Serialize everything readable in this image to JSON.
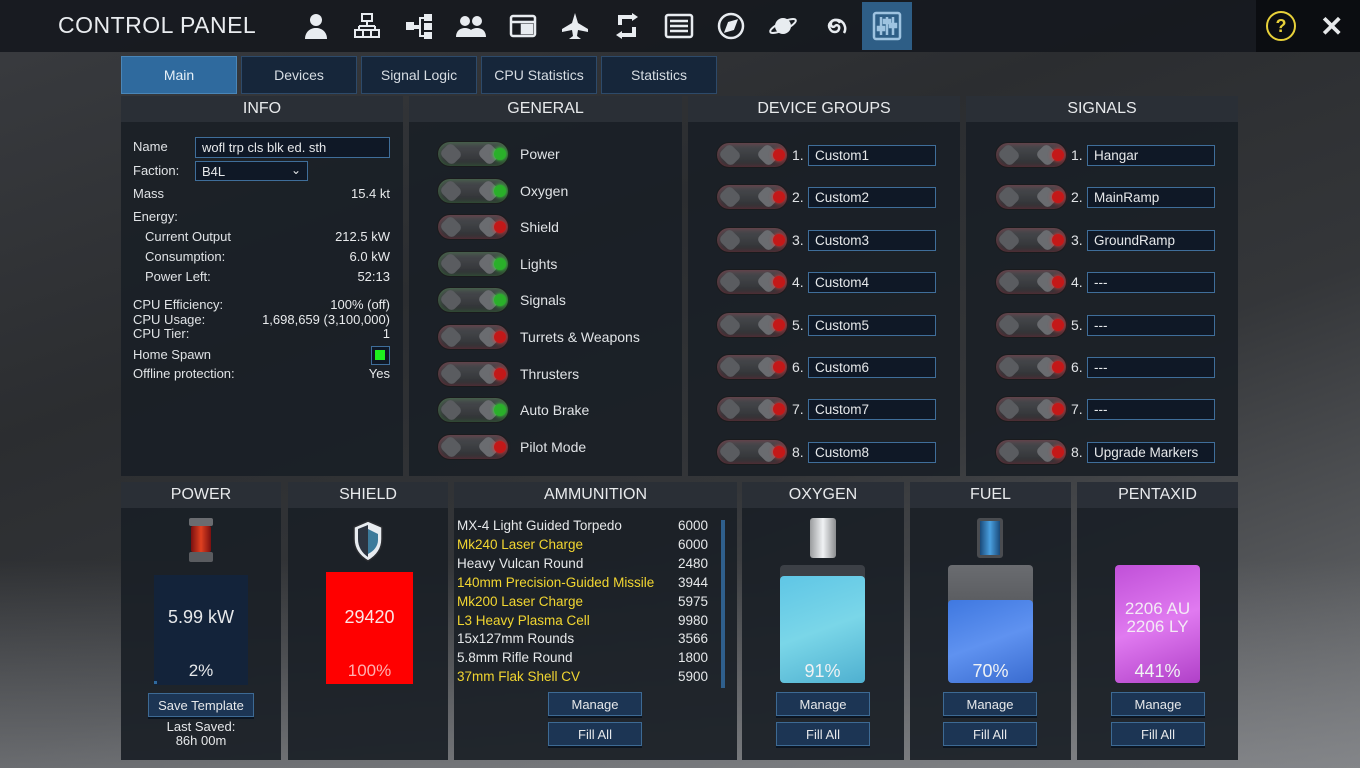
{
  "app": {
    "title": "CONTROL PANEL"
  },
  "toolbar": {
    "icons": [
      "person-icon",
      "structure-icon",
      "network-icon",
      "group-icon",
      "window-icon",
      "ship-icon",
      "swap-icon",
      "list-icon",
      "compass-icon",
      "planet-icon",
      "galaxy-icon",
      "sliders-icon"
    ]
  },
  "tabs": [
    "Main",
    "Devices",
    "Signal Logic",
    "CPU Statistics",
    "Statistics"
  ],
  "info": {
    "header": "INFO",
    "name_label": "Name",
    "name_value": "wofl trp cls blk ed. sth",
    "faction_label": "Faction:",
    "faction_value": "B4L",
    "mass_label": "Mass",
    "mass_value": "15.4 kt",
    "energy_label": "Energy:",
    "current_output_label": "Current Output",
    "current_output_value": "212.5 kW",
    "consumption_label": "Consumption:",
    "consumption_value": "6.0 kW",
    "power_left_label": "Power Left:",
    "power_left_value": "52:13",
    "cpu_eff_label": "CPU Efficiency:",
    "cpu_eff_value": "100% (off)",
    "cpu_usage_label": "CPU Usage:",
    "cpu_usage_value": "1,698,659  (3,100,000)",
    "cpu_tier_label": "CPU Tier:",
    "cpu_tier_value": "1",
    "home_spawn_label": "Home Spawn",
    "offline_label": "Offline protection:",
    "offline_value": "Yes"
  },
  "general": {
    "header": "GENERAL",
    "items": [
      {
        "label": "Power",
        "on": true
      },
      {
        "label": "Oxygen",
        "on": true
      },
      {
        "label": "Shield",
        "on": false
      },
      {
        "label": "Lights",
        "on": true
      },
      {
        "label": "Signals",
        "on": true
      },
      {
        "label": "Turrets & Weapons",
        "on": false
      },
      {
        "label": "Thrusters",
        "on": false
      },
      {
        "label": "Auto Brake",
        "on": true
      },
      {
        "label": "Pilot Mode",
        "on": false
      }
    ]
  },
  "device_groups": {
    "header": "DEVICE GROUPS",
    "items": [
      {
        "num": "1.",
        "name": "Custom1"
      },
      {
        "num": "2.",
        "name": "Custom2"
      },
      {
        "num": "3.",
        "name": "Custom3"
      },
      {
        "num": "4.",
        "name": "Custom4"
      },
      {
        "num": "5.",
        "name": "Custom5"
      },
      {
        "num": "6.",
        "name": "Custom6"
      },
      {
        "num": "7.",
        "name": "Custom7"
      },
      {
        "num": "8.",
        "name": "Custom8"
      }
    ]
  },
  "signals": {
    "header": "SIGNALS",
    "items": [
      {
        "num": "1.",
        "name": "Hangar"
      },
      {
        "num": "2.",
        "name": "MainRamp"
      },
      {
        "num": "3.",
        "name": "GroundRamp"
      },
      {
        "num": "4.",
        "name": "---"
      },
      {
        "num": "5.",
        "name": "---"
      },
      {
        "num": "6.",
        "name": "---"
      },
      {
        "num": "7.",
        "name": "---"
      },
      {
        "num": "8.",
        "name": "Upgrade Markers"
      }
    ]
  },
  "power": {
    "header": "POWER",
    "value": "5.99 kW",
    "percent_text": "2%",
    "percent": 2,
    "save_label": "Save Template",
    "last_saved_label": "Last Saved:",
    "last_saved_value": "86h 00m"
  },
  "shield": {
    "header": "SHIELD",
    "value": "29420",
    "percent_text": "100%",
    "percent": 100
  },
  "ammunition": {
    "header": "AMMUNITION",
    "items": [
      {
        "name": "MX-4 Light Guided Torpedo",
        "value": "6000",
        "highlight": false
      },
      {
        "name": "Mk240 Laser Charge",
        "value": "6000",
        "highlight": true
      },
      {
        "name": "Heavy Vulcan Round",
        "value": "2480",
        "highlight": false
      },
      {
        "name": "140mm Precision-Guided Missile",
        "value": "3944",
        "highlight": true
      },
      {
        "name": "Mk200 Laser Charge",
        "value": "5975",
        "highlight": true
      },
      {
        "name": "L3 Heavy Plasma Cell",
        "value": "9980",
        "highlight": true
      },
      {
        "name": "15x127mm Rounds",
        "value": "3566",
        "highlight": false
      },
      {
        "name": "5.8mm Rifle Round",
        "value": "1800",
        "highlight": false
      },
      {
        "name": "37mm Flak Shell CV",
        "value": "5900",
        "highlight": true
      }
    ],
    "manage_label": "Manage",
    "fill_label": "Fill All"
  },
  "oxygen": {
    "header": "OXYGEN",
    "percent_text": "91%",
    "percent": 91,
    "manage_label": "Manage",
    "fill_label": "Fill All"
  },
  "fuel": {
    "header": "FUEL",
    "percent_text": "70%",
    "percent": 70,
    "manage_label": "Manage",
    "fill_label": "Fill All"
  },
  "pentaxid": {
    "header": "PENTAXID",
    "line1": "2206 AU",
    "line2": "2206 LY",
    "percent_text": "441%",
    "percent": 441,
    "manage_label": "Manage",
    "fill_label": "Fill All"
  },
  "colors": {
    "accent": "#2f6a9e",
    "highlight_text": "#f2d631",
    "shield_fill": "#ff0000",
    "on": "#2ab02a",
    "off": "#c41818"
  }
}
